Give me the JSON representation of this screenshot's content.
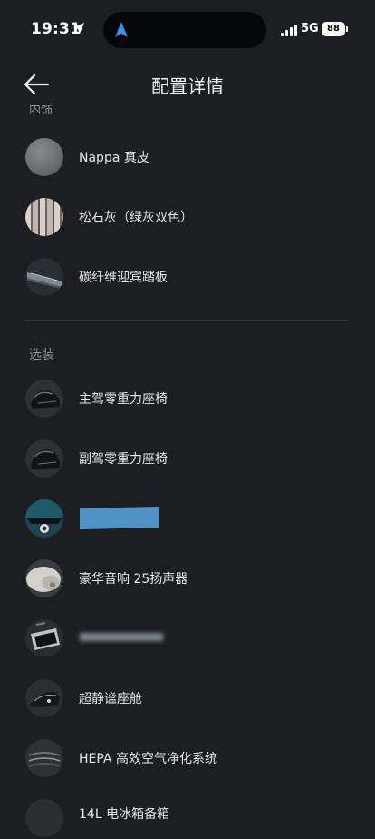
{
  "status_bar": {
    "time": "19:31",
    "network": "5G",
    "battery": "88"
  },
  "header": {
    "title": "配置详情"
  },
  "sections": {
    "interior_partial": "内饰",
    "options": "选装"
  },
  "interior_items": [
    {
      "label": "Nappa 真皮",
      "icon": "leather-swatch"
    },
    {
      "label": "松石灰（绿灰双色）",
      "icon": "color-swatch"
    },
    {
      "label": "碳纤维迎宾踏板",
      "icon": "carbon-sill-plate"
    }
  ],
  "option_items": [
    {
      "label": "主驾零重力座椅",
      "icon": "seat"
    },
    {
      "label": "副驾零重力座椅",
      "icon": "seat"
    },
    {
      "label": "",
      "icon": "car-roof",
      "redacted": "blue-bar"
    },
    {
      "label": "豪华音响 25扬声器",
      "icon": "speaker"
    },
    {
      "label": "",
      "icon": "fridge",
      "redacted": "blur"
    },
    {
      "label": "超静谧座舱",
      "icon": "cabin"
    },
    {
      "label": "HEPA 高效空气净化系统",
      "icon": "air-filter"
    },
    {
      "label": "14L 电冰箱备箱",
      "icon": "fridge-box"
    }
  ],
  "colors": {
    "background": "#1c1e22",
    "text": "#e4e6e9",
    "muted": "#8b8f96",
    "redaction": "#4f93c4"
  }
}
